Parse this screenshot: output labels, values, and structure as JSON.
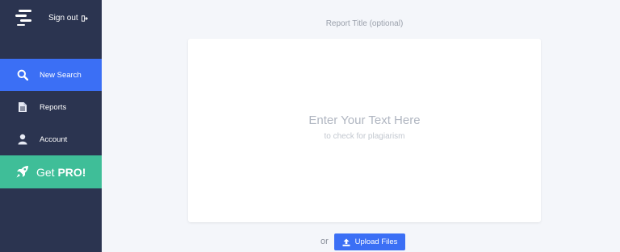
{
  "sidebar": {
    "sign_out_label": "Sign out",
    "nav": [
      {
        "label": "New Search",
        "icon": "search-icon",
        "active": true
      },
      {
        "label": "Reports",
        "icon": "document-icon",
        "active": false
      },
      {
        "label": "Account",
        "icon": "user-icon",
        "active": false
      }
    ],
    "pro": {
      "prefix": "Get ",
      "highlight": "PRO!",
      "icon": "rocket-icon"
    }
  },
  "main": {
    "report_title_placeholder": "Report Title (optional)",
    "text_placeholder_main": "Enter Your Text Here",
    "text_placeholder_sub": "to check for plagiarism",
    "or_label": "or",
    "upload_label": "Upload Files"
  },
  "colors": {
    "sidebar": "#2b3450",
    "accent": "#3b6ff5",
    "pro": "#3fbe98",
    "background": "#f4f6fa"
  }
}
